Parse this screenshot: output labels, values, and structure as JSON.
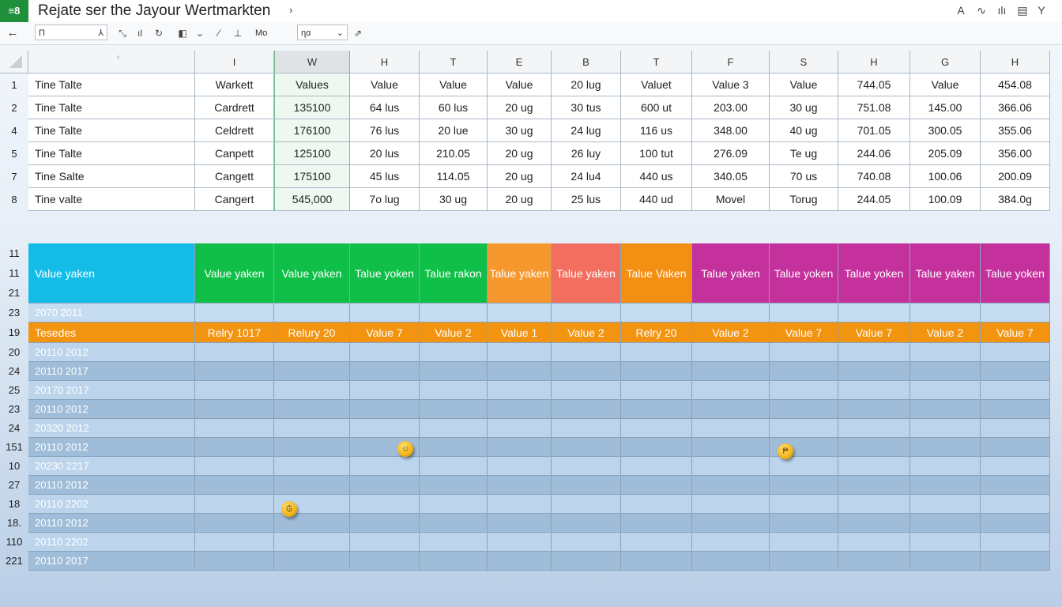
{
  "window": {
    "app_icon": "≡8",
    "title": "Rejate ser the Jayour Wertmarkten",
    "title_arrow": "›",
    "right_icons": [
      "A",
      "∿",
      "ılı",
      "▤",
      "Y"
    ]
  },
  "toolbar": {
    "back": "←",
    "name_box": "Π",
    "name_box_suffix": "⅄",
    "glyphs_a": [
      "⤡",
      "ıl",
      "↻",
      "◧",
      "⌄",
      "⁄",
      "⊥"
    ],
    "font_label": "Mo",
    "find_box": "ɳɑ",
    "find_suffix": "⌄",
    "find_extra": "⇗"
  },
  "colors": {
    "green_sel": "#6fbf8e",
    "cyan": "#14bde8",
    "green": "#0fbf47",
    "orange": "#f7982e",
    "salmon": "#f26e5e",
    "amber": "#f38f12",
    "magenta": "#c4309c",
    "orange_row": "#f29410"
  },
  "columns": [
    "",
    "I",
    "W",
    "H",
    "T",
    "E",
    "B",
    "T",
    "F",
    "S",
    "H",
    "G",
    "H"
  ],
  "corner_mark": "‹",
  "top_rows": [
    {
      "n": "1",
      "cells": [
        "Tine Talte",
        "Warkett",
        "Values",
        "Value",
        "Value",
        "Value",
        "20 lug",
        "Valuet",
        "Value 3",
        "Value",
        "744.05",
        "Value",
        "454.08"
      ]
    },
    {
      "n": "2",
      "cells": [
        "Tine Talte",
        "Cardrett",
        "135100",
        "64 lus",
        "60 lus",
        "20 ug",
        "30 tus",
        "600 ut",
        "203.00",
        "30 ug",
        "751.08",
        "145.00",
        "366.06"
      ]
    },
    {
      "n": "4",
      "cells": [
        "Tine Talte",
        "Celdrett",
        "176100",
        "76 lus",
        "20 lue",
        "30 ug",
        "24 lug",
        "116 us",
        "348.00",
        "40 ug",
        "701.05",
        "300.05",
        "355.06"
      ]
    },
    {
      "n": "5",
      "cells": [
        "Tine Talte",
        "Canpett",
        "125100",
        "20 lus",
        "210.05",
        "20 ug",
        "26 luy",
        "100 tut",
        "276.09",
        "Te ug",
        "244.06",
        "205.09",
        "356.00"
      ]
    },
    {
      "n": "7",
      "cells": [
        "Tine Salte",
        "Cangett",
        "175100",
        "45 lus",
        "114.05",
        "20 ug",
        "24 lu4",
        "440 us",
        "340.05",
        "70 us",
        "740.08",
        "100.06",
        "200.09"
      ]
    },
    {
      "n": "8",
      "cells": [
        "Tine valte",
        "Cangert",
        "545,000",
        "7o lug",
        "30 ug",
        "20 ug",
        "25 lus",
        "440 ud",
        "Movel",
        "Torug",
        "244.05",
        "100.09",
        "384.0g"
      ]
    }
  ],
  "header_band": {
    "rownums": [
      "11",
      "11",
      "21"
    ],
    "first": "Value yaken",
    "labels": [
      "Value yaken",
      "Value yaken",
      "Talue yoken",
      "Talue rakon",
      "Talue yaken",
      "Talue yaken",
      "Talue Vaken",
      "Talue yaken",
      "Talue yoken",
      "Talue yoken",
      "Talue yaken",
      "Talue yoken"
    ]
  },
  "row23": {
    "n": "23",
    "label": "2070 2011"
  },
  "orange_row": {
    "n": "19",
    "first": "Tesedes",
    "labels": [
      "Relry 1017",
      "Relury 20",
      "Value 7",
      "Value 2",
      "Value 1",
      "Value 2",
      "Relry 20",
      "Value 2",
      "Value 7",
      "Value 7",
      "Value 2",
      "Value 7"
    ]
  },
  "lower_rows": [
    {
      "n": "20",
      "label": "20110 2012"
    },
    {
      "n": "24",
      "label": "20110 2017"
    },
    {
      "n": "25",
      "label": "20170 2017"
    },
    {
      "n": "23",
      "label": "20110 2012"
    },
    {
      "n": "24",
      "label": "20320 2012"
    },
    {
      "n": "151",
      "label": "20110 2012"
    },
    {
      "n": "10",
      "label": "20230 2217"
    },
    {
      "n": "27",
      "label": "20110 2012"
    },
    {
      "n": "18",
      "label": "20110 2202"
    },
    {
      "n": "18.",
      "label": "20110 2012"
    },
    {
      "n": "110",
      "label": "20110 2202"
    },
    {
      "n": "221",
      "label": "20110 2017"
    }
  ],
  "coins": [
    "☺",
    "₱",
    "₲"
  ]
}
